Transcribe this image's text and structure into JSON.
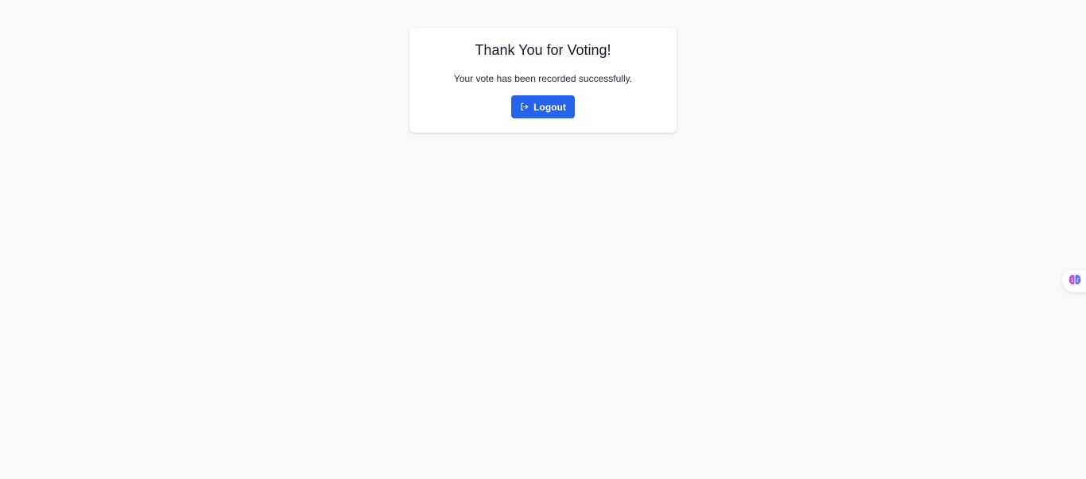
{
  "card": {
    "title": "Thank You for Voting!",
    "message": "Your vote has been recorded successfully.",
    "logout_label": "Logout",
    "logout_icon": "logout-icon"
  },
  "side_widget": {
    "icon": "brain-icon"
  },
  "colors": {
    "background": "#f8f9fb",
    "card": "#ffffff",
    "button": "#2563eb",
    "button_text": "#ffffff",
    "title": "#111827"
  }
}
